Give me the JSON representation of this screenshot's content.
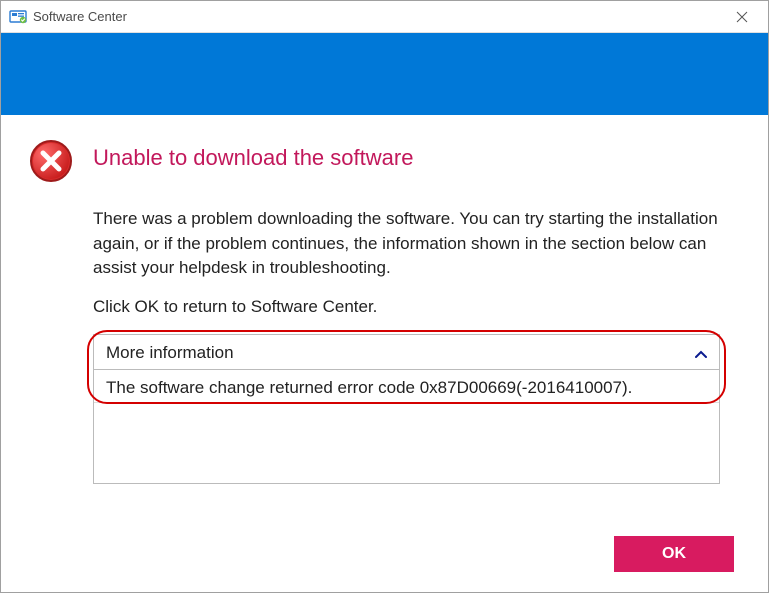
{
  "titlebar": {
    "title": "Software Center"
  },
  "dialog": {
    "heading": "Unable to download the software",
    "paragraph1": "There was a problem downloading the software.  You can try starting the installation again, or if the problem continues, the information shown in the section below can assist your helpdesk in troubleshooting.",
    "paragraph2": "Click OK to return to Software Center."
  },
  "info": {
    "header": "More information",
    "detail": "The software change returned error code 0x87D00669(-2016410007)."
  },
  "buttons": {
    "ok": "OK"
  }
}
